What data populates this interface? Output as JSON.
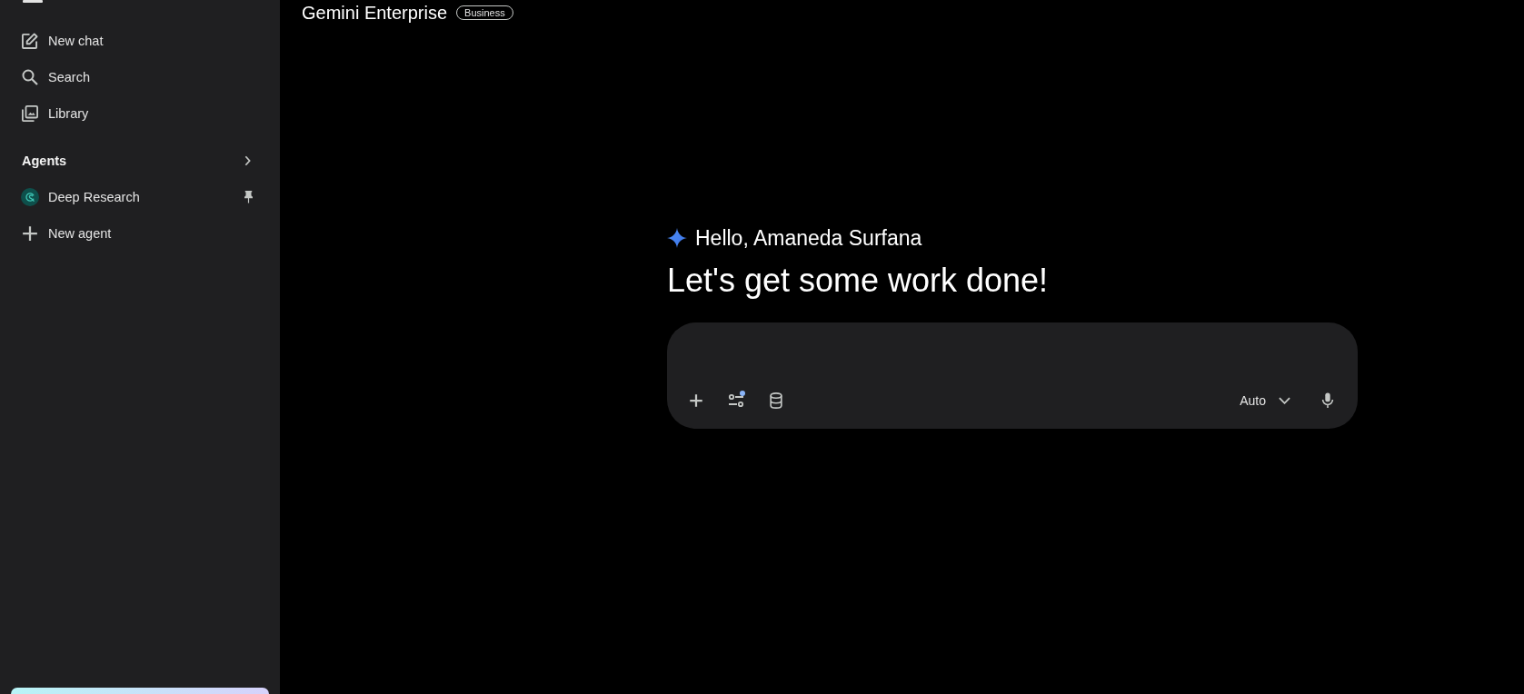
{
  "sidebar": {
    "nav": [
      {
        "kind": "compose",
        "label": "New chat"
      },
      {
        "kind": "search",
        "label": "Search"
      },
      {
        "kind": "library",
        "label": "Library"
      }
    ],
    "agents": {
      "title": "Agents",
      "items": [
        {
          "label": "Deep Research",
          "pinned": true
        }
      ],
      "new_label": "New agent"
    }
  },
  "header": {
    "title": "Gemini Enterprise",
    "badge": "Business"
  },
  "greeting": {
    "hello": "Hello, Amaneda Surfana",
    "headline": "Let's get some work done!"
  },
  "prompt": {
    "tools_badge": true,
    "mode": "Auto"
  }
}
